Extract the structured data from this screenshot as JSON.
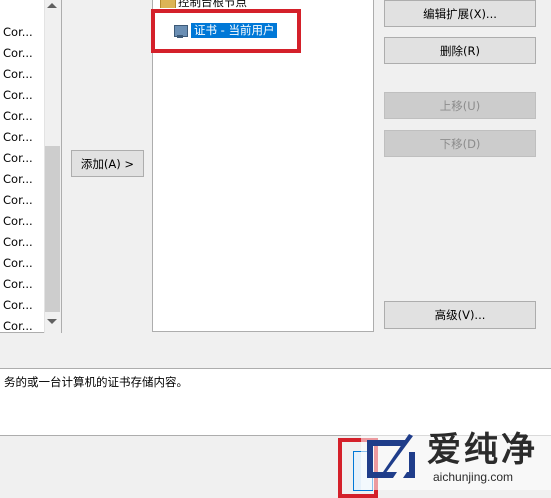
{
  "left_list": {
    "items": [
      "Cor...",
      "Cor...",
      "Cor...",
      "Cor...",
      "Cor...",
      "Cor...",
      "Cor...",
      "Cor...",
      "Cor...",
      "Cor...",
      "Cor...",
      "Cor...",
      "Cor...",
      "Cor...",
      "Cor..."
    ]
  },
  "buttons": {
    "add": "添加(A) >",
    "edit_ext": "编辑扩展(X)...",
    "delete": "删除(R)",
    "move_up": "上移(U)",
    "move_down": "下移(D)",
    "advanced": "高级(V)..."
  },
  "tree": {
    "partial_node": "控制台根节点",
    "selected_node": "证书 - 当前用户"
  },
  "description": "务的或一台计算机的证书存储内容。",
  "watermark": {
    "title": "爱纯净",
    "url": "aichunjing.com"
  },
  "colors": {
    "highlight": "#0078d7",
    "annotation_red": "#d4202a"
  }
}
